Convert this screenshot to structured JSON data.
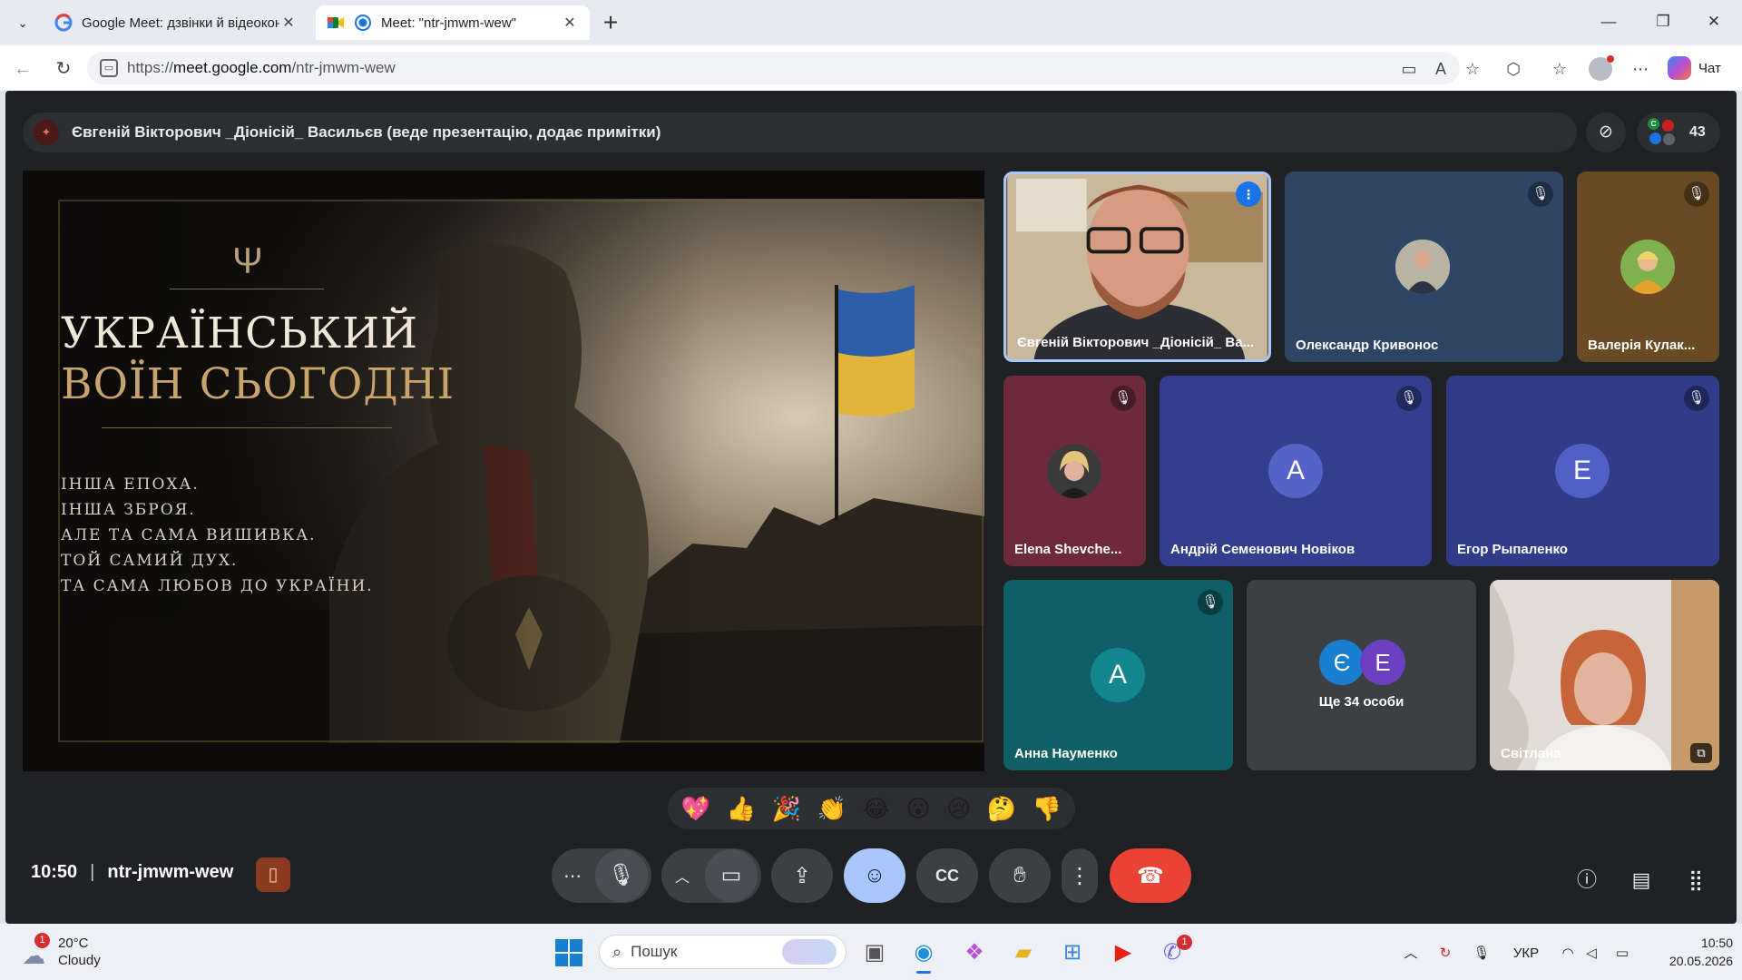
{
  "browser": {
    "tabs": [
      {
        "title": "Google Meet: дзвінки й відеоконференції",
        "active": false
      },
      {
        "title": "Meet: \"ntr-jmwm-wew\"",
        "active": true
      }
    ],
    "new_tab": "+",
    "window": {
      "minimize": "—",
      "maximize": "❐",
      "close": "✕"
    },
    "url_prefix": "https://",
    "url_host": "meet.google.com",
    "url_path": "/ntr-jmwm-wew",
    "copilot_label": "Чат"
  },
  "meet": {
    "presenter_banner": "Євгеній Вікторович _Діонісій_ Васильєв (веде презентацію, додає примітки)",
    "participant_count": "43",
    "slide": {
      "title_line1": "УКРАЇНСЬКИЙ",
      "title_line2": "ВОЇН СЬОГОДНІ",
      "lines": [
        "ІНША ЕПОХА.",
        "ІНША ЗБРОЯ.",
        "АЛЕ ТА САМА ВИШИВКА.",
        "ТОЙ САМИЙ ДУХ.",
        "ТА САМА ЛЮБОВ ДО УКРАЇНИ."
      ]
    },
    "tiles": [
      {
        "name": "Євгеній Вікторович _Діонісій_ Ва...",
        "state": "speaking"
      },
      {
        "name": "Олександр Кривонос",
        "state": "muted",
        "bg": "#2e4566"
      },
      {
        "name": "Валерія Кулак...",
        "state": "muted",
        "bg": "#6a4a22"
      },
      {
        "name": "Elena Shevche...",
        "state": "muted",
        "bg": "#6e2a3c"
      },
      {
        "name": "Андрій Семенович Новіков",
        "state": "muted",
        "initial": "А",
        "bg": "#323f8e",
        "avatar_color": "#5563c7"
      },
      {
        "name": "Егор Рыпаленко",
        "state": "muted",
        "initial": "Е",
        "bg": "#303c8a",
        "avatar_color": "#5060c8"
      },
      {
        "name": "Анна Науменко",
        "state": "muted",
        "initial": "А",
        "bg": "#0e5f66",
        "avatar_color": "#14878d"
      },
      {
        "name": "Ще 34 особи",
        "initials": [
          "Є",
          "Е"
        ],
        "avatar_colors": [
          "#1a7fd1",
          "#6b3fbf"
        ],
        "bg": "#3c4043"
      },
      {
        "name": "Світлана",
        "state": "video"
      }
    ],
    "reactions": [
      "💖",
      "👍",
      "🎉",
      "👏",
      "😂",
      "😮",
      "😢",
      "🤔",
      "👎"
    ],
    "time": "10:50",
    "meeting_code": "ntr-jmwm-wew",
    "colors": {
      "end_call": "#ea4335",
      "reactions_active": "#a8c7fa",
      "speaking_border": "#a8c7fa"
    }
  },
  "taskbar": {
    "weather": {
      "temp": "20°C",
      "condition": "Cloudy",
      "badge": "1"
    },
    "search_placeholder": "Пошук",
    "app_badge": "1",
    "language": "УКР",
    "time": "10:50",
    "date": "20.05.2026"
  }
}
